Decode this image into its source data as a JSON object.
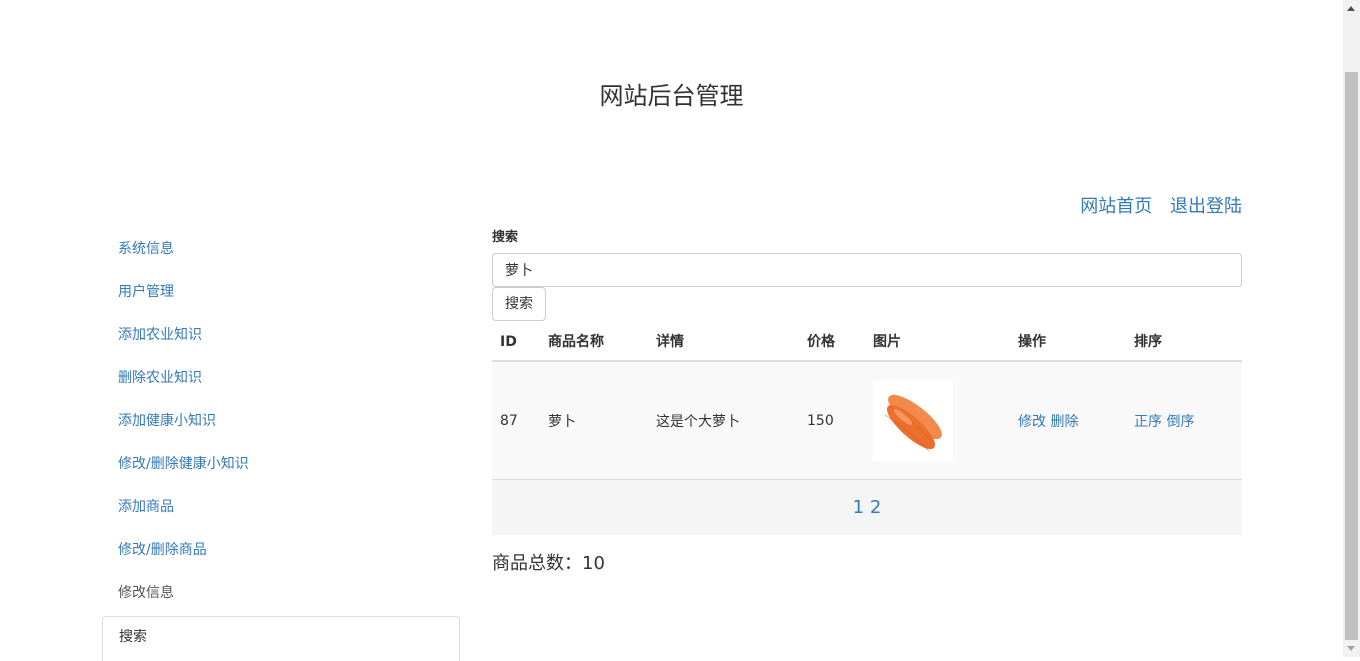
{
  "header": {
    "title": "网站后台管理",
    "links": [
      "网站首页",
      "退出登陆"
    ]
  },
  "sidebar": {
    "items": [
      {
        "label": "系统信息"
      },
      {
        "label": "用户管理"
      },
      {
        "label": "添加农业知识"
      },
      {
        "label": "删除农业知识"
      },
      {
        "label": "添加健康小知识"
      },
      {
        "label": "修改/删除健康小知识"
      },
      {
        "label": "添加商品"
      },
      {
        "label": "修改/删除商品"
      },
      {
        "label": "修改信息"
      },
      {
        "label": "搜索"
      }
    ],
    "active": "搜索"
  },
  "search": {
    "label": "搜索",
    "value": "萝卜",
    "button": "搜索"
  },
  "table": {
    "headers": [
      "ID",
      "商品名称",
      "详情",
      "价格",
      "图片",
      "操作",
      "排序"
    ],
    "rows": [
      {
        "id": "87",
        "name": "萝卜",
        "detail": "这是个大萝卜",
        "price": "150",
        "image_icon": "carrot-image",
        "edit": "修改",
        "delete": "删除",
        "sort_asc": "正序",
        "sort_desc": "倒序"
      }
    ],
    "pages": [
      "1",
      "2"
    ]
  },
  "summary": {
    "label": "商品总数：",
    "value": "10"
  },
  "colors": {
    "link": "#337ab7",
    "carrot": "#f07a3a"
  }
}
